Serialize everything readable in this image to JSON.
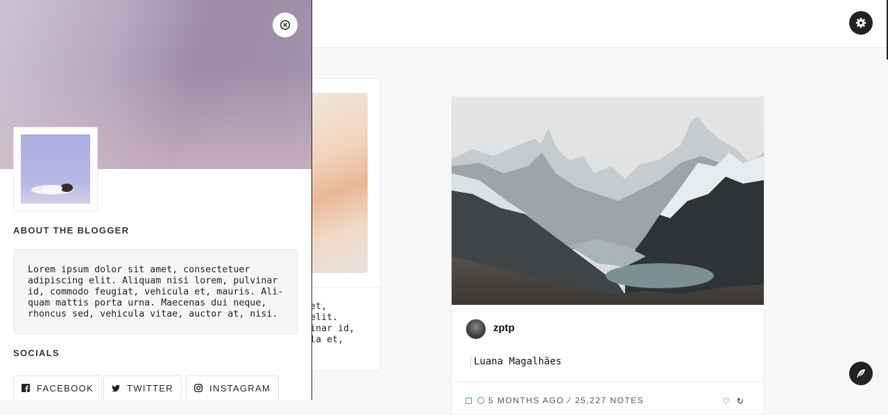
{
  "header": {
    "settings_icon": "gear-icon",
    "colors": {
      "button_bg": "#222222",
      "bar_bg": "#ffffff"
    }
  },
  "background_post": {
    "text_lines": [
      "amet,",
      "g elit.",
      "lvinar id,",
      "cula et,"
    ]
  },
  "main_post": {
    "author": "zptp",
    "text": "Luana Magalhães",
    "meta": {
      "type_icon": "photo-icon",
      "time": "5 MONTHS AGO",
      "notes": "25,227 NOTES"
    },
    "action_icons": [
      "heart-icon",
      "reblog-icon"
    ]
  },
  "sidebar": {
    "close_icon": "close-circle-icon",
    "about_title": "ABOUT THE BLOGGER",
    "about_lines": [
      "Lorem ipsum dolor sit amet, consectetuer",
      "adipiscing elit. Aliquam nisi lorem, pulvinar",
      "id, commodo feugiat, vehicula et, mauris. Ali-",
      "quam mattis porta urna. Maecenas dui neque,",
      "rhoncus sed, vehicula vitae, auctor at, nisi."
    ],
    "socials_title": "SOCIALS",
    "socials": [
      {
        "label": "FACEBOOK",
        "icon": "facebook-icon"
      },
      {
        "label": "TWITTER",
        "icon": "twitter-icon"
      },
      {
        "label": "INSTAGRAM",
        "icon": "instagram-icon"
      }
    ]
  },
  "floating": {
    "compose_icon": "feather-icon",
    "accent": "#3aa6b9"
  }
}
